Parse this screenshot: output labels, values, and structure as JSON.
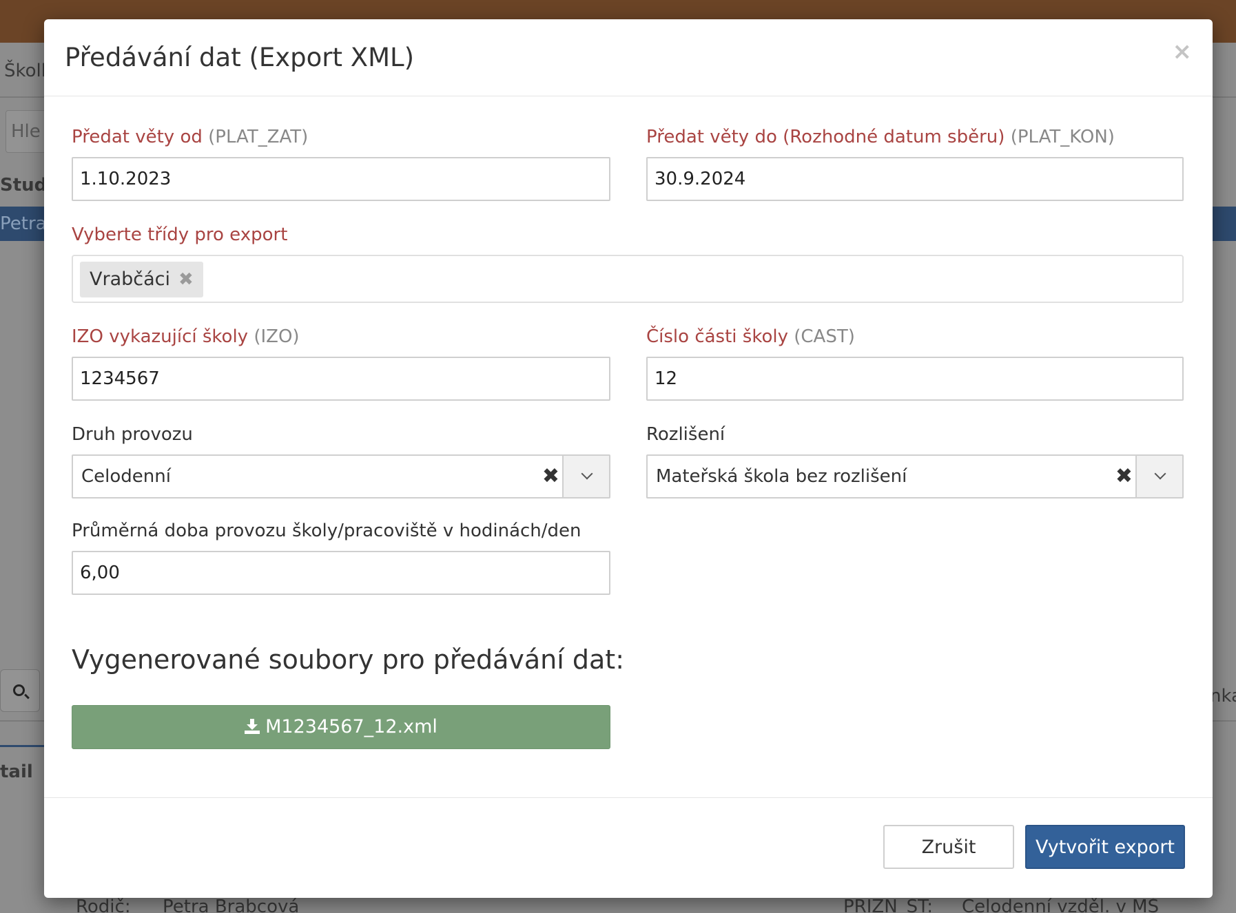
{
  "background": {
    "breadcrumb": "Školk",
    "search_fragment": "Hle",
    "column_header": "Stude",
    "selected_row": "Petra",
    "detail_heading": "tail",
    "right_fragment": "nka",
    "footer_label_1": "Rodič:",
    "footer_value_1": "Petra Brabcová",
    "footer_label_2": "PRIZN_ST:",
    "footer_value_2": "Celodenní vzděl. v MŠ"
  },
  "modal": {
    "title": "Předávání dat (Export XML)",
    "close_symbol": "×",
    "fields": {
      "plat_zat": {
        "label": "Předat věty od",
        "code": "(PLAT_ZAT)",
        "value": "1.10.2023"
      },
      "plat_kon": {
        "label": "Předat věty do (Rozhodné datum sběru)",
        "code": "(PLAT_KON)",
        "value": "30.9.2024"
      },
      "classes": {
        "label": "Vyberte třídy pro export",
        "tags": [
          "Vrabčáci"
        ],
        "tag_remove_symbol": "✖"
      },
      "izo": {
        "label": "IZO vykazující školy",
        "code": "(IZO)",
        "value": "1234567"
      },
      "cast": {
        "label": "Číslo části školy",
        "code": "(CAST)",
        "value": "12"
      },
      "druh_provozu": {
        "label": "Druh provozu",
        "value": "Celodenní",
        "clear_symbol": "✖"
      },
      "rozliseni": {
        "label": "Rozlišení",
        "value": "Mateřská škola bez rozlišení",
        "clear_symbol": "✖"
      },
      "doba_provozu": {
        "label": "Průměrná doba provozu školy/pracoviště v hodinách/den",
        "value": "6,00"
      }
    },
    "generated_heading": "Vygenerované soubory pro předávání dat:",
    "generated_files": [
      "M1234567_12.xml"
    ],
    "buttons": {
      "cancel": "Zrušit",
      "create": "Vytvořit export"
    }
  },
  "colors": {
    "required_label": "#a94442",
    "download_button": "#79a079",
    "primary_button": "#336199",
    "top_bar": "#6b4426"
  }
}
